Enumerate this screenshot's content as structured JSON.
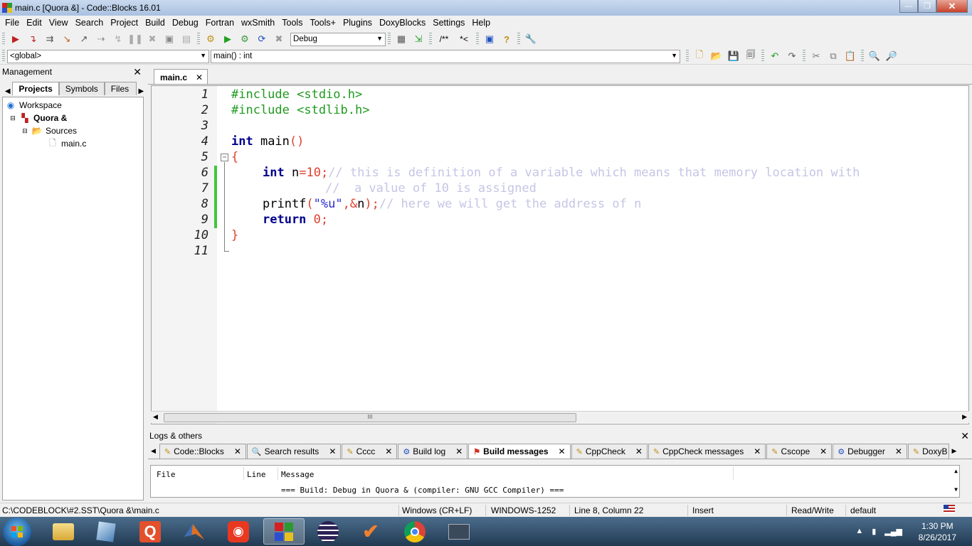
{
  "window": {
    "title": "main.c [Quora &] - Code::Blocks 16.01",
    "min_label": "—",
    "max_label": "❐",
    "close_label": "✕"
  },
  "menu": [
    "File",
    "Edit",
    "View",
    "Search",
    "Project",
    "Build",
    "Debug",
    "Fortran",
    "wxSmith",
    "Tools",
    "Tools+",
    "Plugins",
    "DoxyBlocks",
    "Settings",
    "Help"
  ],
  "toolbar": {
    "build_target": "Debug",
    "doxy_block": "/**",
    "doxy_line": "*<"
  },
  "codebrowser": {
    "scope": "<global>",
    "function": "main() : int"
  },
  "management": {
    "title": "Management",
    "tabs": [
      "Projects",
      "Symbols",
      "Files"
    ],
    "tree": {
      "workspace": "Workspace",
      "project": "Quora &",
      "folder": "Sources",
      "file": "main.c"
    }
  },
  "editor": {
    "tab": "main.c",
    "line_numbers": [
      "1",
      "2",
      "3",
      "4",
      "5",
      "6",
      "7",
      "8",
      "9",
      "10",
      "11"
    ],
    "code": {
      "l1": "#include <stdio.h>",
      "l2": "#include <stdlib.h>",
      "l4_kw": "int",
      "l4_rest": " main",
      "l4_paren": "()",
      "l5": "{",
      "l6_kw": "int",
      "l6_id": " n",
      "l6_op": "=",
      "l6_num": "10",
      "l6_semi": ";",
      "l6_comment": "// this is definition of a variable which means that memory location with",
      "l7_comment": "//  a value of 10 is assigned",
      "l8_id": "printf",
      "l8_open": "(",
      "l8_str": "\"%u\"",
      "l8_mid": ",&",
      "l8_id2": "n",
      "l8_close": ");",
      "l8_comment": "// here we will get the address of n",
      "l9_kw": "return",
      "l9_num": "0",
      "l9_semi": ";",
      "l10": "}"
    },
    "scroll_thumb": "III"
  },
  "logs": {
    "title": "Logs & others",
    "tabs": [
      "Code::Blocks",
      "Search results",
      "Cccc",
      "Build log",
      "Build messages",
      "CppCheck",
      "CppCheck messages",
      "Cscope",
      "Debugger",
      "DoxyB"
    ],
    "active_tab": "Build messages",
    "columns": [
      "File",
      "Line",
      "Message"
    ],
    "rows": [
      "=== Build: Debug in Quora & (compiler: GNU GCC Compiler) ==="
    ]
  },
  "status": {
    "path": "C:\\CODEBLOCK\\#2.SST\\Quora &\\main.c",
    "eol": "Windows (CR+LF)",
    "encoding": "WINDOWS-1252",
    "position": "Line 8, Column 22",
    "mode": "Insert",
    "access": "Read/Write",
    "lang": "default"
  },
  "taskbar": {
    "time": "1:30 PM",
    "date": "8/26/2017"
  },
  "colors": {
    "preprocessor": "#1f9a1f",
    "keyword": "#00008b",
    "number": "#e0402f",
    "comment": "#c5c5e6",
    "change_bar": "#3ec73e"
  }
}
